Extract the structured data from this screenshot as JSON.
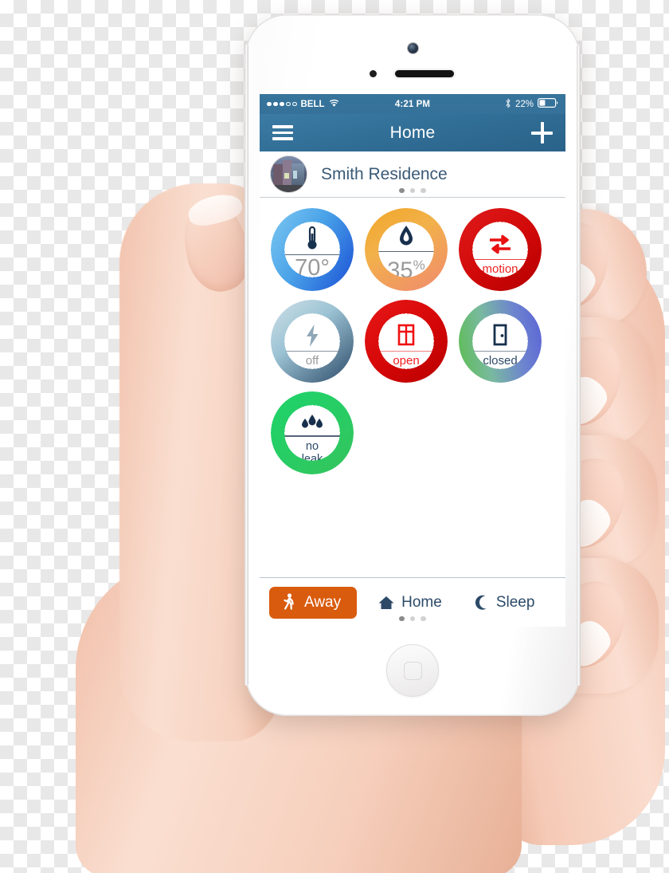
{
  "status_bar": {
    "signal_dots_filled": 3,
    "signal_dots_total": 5,
    "carrier": "BELL",
    "wifi_icon": "wifi-icon",
    "time": "4:21 PM",
    "bluetooth_icon": "bluetooth-icon",
    "battery_percent": "22%",
    "battery_level": 22
  },
  "nav_bar": {
    "menu_icon": "hamburger-menu-icon",
    "title": "Home",
    "add_icon": "plus-icon",
    "background_color": "#2f6b93"
  },
  "residence": {
    "thumbnail_icon": "house-photo-thumbnail",
    "name": "Smith Residence",
    "page_dots": 3,
    "active_dot": 0
  },
  "tiles": [
    {
      "name": "temperature",
      "icon": "thermometer-icon",
      "value": "70",
      "unit": "°",
      "ring_from": "#7ec8f2",
      "ring_to": "#1a4fd6",
      "icon_color": "#17304d",
      "text_color": "#9a9a9a",
      "rule_color": "#55657a"
    },
    {
      "name": "humidity",
      "icon": "water-drop-icon",
      "value": "35",
      "unit": "%",
      "ring_from": "#f0a628",
      "ring_to": "#f07a6a",
      "icon_color": "#17304d",
      "text_color": "#9a9a9a",
      "rule_color": "#55657a"
    },
    {
      "name": "motion",
      "icon": "motion-arrows-icon",
      "value": "motion",
      "unit": "",
      "ring_from": "#e01b1b",
      "ring_to": "#c00000",
      "icon_color": "#e81010",
      "text_color": "#ee2222",
      "rule_color": "#ee3a3a"
    },
    {
      "name": "power",
      "icon": "lightning-bolt-icon",
      "value": "off",
      "unit": "",
      "ring_from": "#9cc3d4",
      "ring_to": "#2c4a68",
      "icon_color": "#8fa7b8",
      "text_color": "#9a9a9a",
      "rule_color": "#8a95a3"
    },
    {
      "name": "window",
      "icon": "window-icon",
      "value": "open",
      "unit": "",
      "ring_from": "#e01b1b",
      "ring_to": "#c00000",
      "icon_color": "#f01010",
      "text_color": "#f02020",
      "rule_color": "#f08080"
    },
    {
      "name": "door",
      "icon": "door-icon",
      "value": "closed",
      "unit": "",
      "ring_from": "#5bbd4d",
      "ring_to": "#5a62d6",
      "icon_color": "#17304d",
      "text_color": "#2c4a68",
      "rule_color": "#8a95a3"
    },
    {
      "name": "leak",
      "icon": "water-droplets-icon",
      "value": "no\nleak",
      "unit": "",
      "ring_from": "#1fd36a",
      "ring_to": "#33c75f",
      "icon_color": "#17304d",
      "text_color": "#2c4a68",
      "rule_color": "#55657a"
    }
  ],
  "bottom_bar": {
    "modes": [
      {
        "label": "Away",
        "icon": "walking-person-icon",
        "active": true
      },
      {
        "label": "Home",
        "icon": "house-icon",
        "active": false
      },
      {
        "label": "Sleep",
        "icon": "crescent-moon-icon",
        "active": false
      }
    ],
    "active_color": "#d95b0d",
    "page_dots": 3,
    "active_dot": 0
  }
}
